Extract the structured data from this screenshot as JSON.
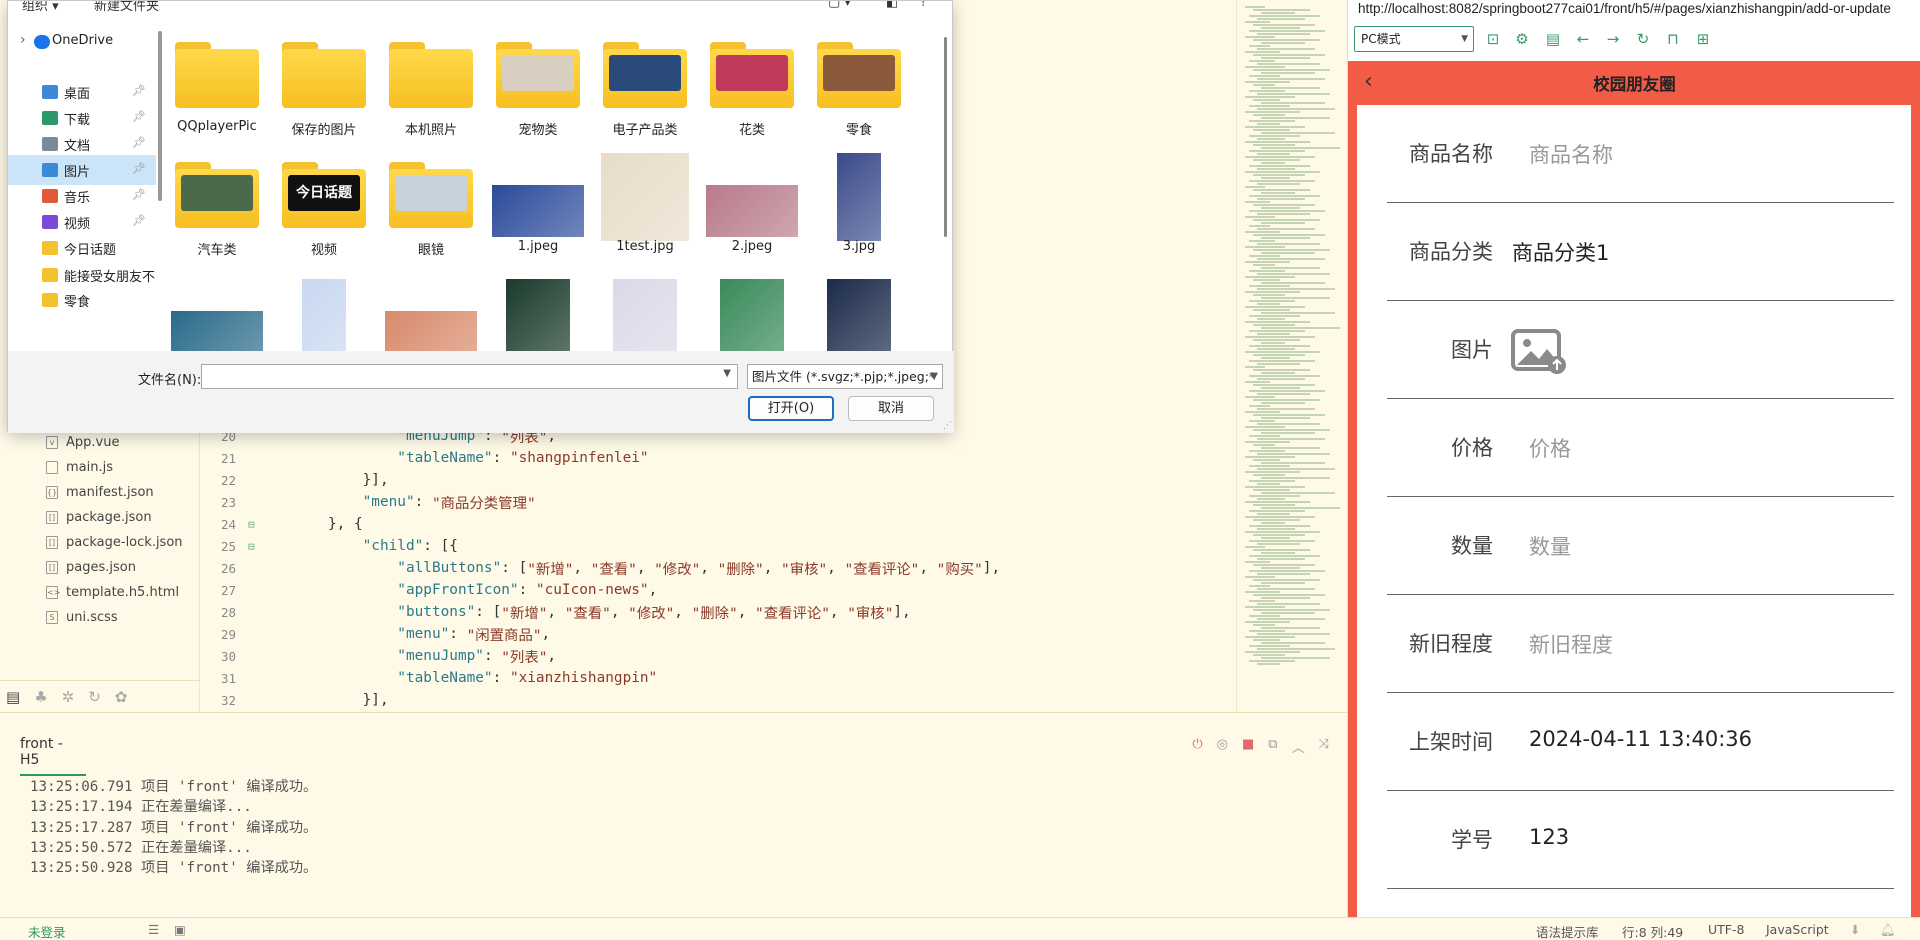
{
  "dialog": {
    "toolbar": {
      "organize": "组织 ▾",
      "new_folder": "新建文件夹"
    },
    "nav": [
      {
        "label": "OneDrive",
        "color": "#1a73e8",
        "pinned": false,
        "expander": true
      },
      {
        "label": "桌面",
        "color": "#3a8ad8",
        "pinned": true
      },
      {
        "label": "下载",
        "color": "#2a9a6a",
        "pinned": true
      },
      {
        "label": "文档",
        "color": "#7a8a9a",
        "pinned": true
      },
      {
        "label": "图片",
        "color": "#3a8ad8",
        "pinned": true,
        "selected": true
      },
      {
        "label": "音乐",
        "color": "#e05a3a",
        "pinned": true
      },
      {
        "label": "视频",
        "color": "#7a4ad8",
        "pinned": true
      },
      {
        "label": "今日话题",
        "color": "#f3c22e",
        "pinned": false
      },
      {
        "label": "能接受女朋友不",
        "color": "#f3c22e",
        "pinned": false
      },
      {
        "label": "零食",
        "color": "#f3c22e",
        "pinned": false
      }
    ],
    "items": [
      {
        "label": "QQplayerPic",
        "kind": "folder"
      },
      {
        "label": "保存的图片",
        "kind": "folder"
      },
      {
        "label": "本机照片",
        "kind": "folder"
      },
      {
        "label": "宠物类",
        "kind": "folder",
        "thumb": "#d9cfc0"
      },
      {
        "label": "电子产品类",
        "kind": "folder",
        "thumb": "#2a4a7a"
      },
      {
        "label": "花类",
        "kind": "folder",
        "thumb": "#c03a5a"
      },
      {
        "label": "零食",
        "kind": "folder",
        "thumb": "#8a5a3a"
      },
      {
        "label": "汽车类",
        "kind": "folder",
        "thumb": "#4a6a4a"
      },
      {
        "label": "视频",
        "kind": "folder",
        "thumb": "#111111",
        "thumb_text": "今日话题"
      },
      {
        "label": "眼镜",
        "kind": "folder",
        "thumb": "#c8d2dc"
      },
      {
        "label": "1.jpeg",
        "kind": "image",
        "color": "#2a4a9a"
      },
      {
        "label": "1test.jpg",
        "kind": "image",
        "color": "#e8dcc8"
      },
      {
        "label": "2.jpeg",
        "kind": "image",
        "color": "#b87a8a"
      },
      {
        "label": "3.jpg",
        "kind": "image",
        "color": "#3a4a8a"
      },
      {
        "label": "",
        "kind": "image",
        "color": "#2a6a8a"
      },
      {
        "label": "",
        "kind": "image",
        "color": "#c8d8f0"
      },
      {
        "label": "",
        "kind": "image",
        "color": "#d88a6a"
      },
      {
        "label": "",
        "kind": "image",
        "color": "#1a3a2a"
      },
      {
        "label": "",
        "kind": "image",
        "color": "#ddd8e8"
      },
      {
        "label": "",
        "kind": "image",
        "color": "#3a8a5a"
      },
      {
        "label": "",
        "kind": "image",
        "color": "#1a2a4a"
      }
    ],
    "filename_label": "文件名(N):",
    "filename_value": "",
    "filetype": "图片文件 (*.svgz;*.pjp;*.jpeg;*",
    "open_button": "打开(O)",
    "cancel_button": "取消"
  },
  "project_tree": {
    "files": [
      {
        "name": "App.vue",
        "icon": "v"
      },
      {
        "name": "main.js",
        "icon": ""
      },
      {
        "name": "manifest.json",
        "icon": "{}"
      },
      {
        "name": "package.json",
        "icon": "[]"
      },
      {
        "name": "package-lock.json",
        "icon": "[]"
      },
      {
        "name": "pages.json",
        "icon": "[]"
      },
      {
        "name": "template.h5.html",
        "icon": "<>"
      },
      {
        "name": "uni.scss",
        "icon": "S"
      }
    ]
  },
  "code": {
    "lines": [
      {
        "num": "20",
        "fold": "",
        "indent": 8,
        "parts": [
          [
            "k",
            "\"menuJump\""
          ],
          [
            "p",
            ": "
          ],
          [
            "s",
            "\"列表\""
          ],
          [
            "p",
            ","
          ]
        ]
      },
      {
        "num": "21",
        "fold": "",
        "indent": 8,
        "parts": [
          [
            "k",
            "\"tableName\""
          ],
          [
            "p",
            ": "
          ],
          [
            "s",
            "\"shangpinfenlei\""
          ]
        ]
      },
      {
        "num": "22",
        "fold": "",
        "indent": 6,
        "parts": [
          [
            "p",
            "}],"
          ]
        ]
      },
      {
        "num": "23",
        "fold": "",
        "indent": 6,
        "parts": [
          [
            "k",
            "\"menu\""
          ],
          [
            "p",
            ": "
          ],
          [
            "s",
            "\"商品分类管理\""
          ]
        ]
      },
      {
        "num": "24",
        "fold": "⊟",
        "indent": 4,
        "parts": [
          [
            "p",
            "}, {"
          ]
        ]
      },
      {
        "num": "25",
        "fold": "⊟",
        "indent": 6,
        "parts": [
          [
            "k",
            "\"child\""
          ],
          [
            "p",
            ": [{"
          ]
        ]
      },
      {
        "num": "26",
        "fold": "",
        "indent": 8,
        "parts": [
          [
            "k",
            "\"allButtons\""
          ],
          [
            "p",
            ": ["
          ],
          [
            "s",
            "\"新增\""
          ],
          [
            "p",
            ", "
          ],
          [
            "s",
            "\"查看\""
          ],
          [
            "p",
            ", "
          ],
          [
            "s",
            "\"修改\""
          ],
          [
            "p",
            ", "
          ],
          [
            "s",
            "\"删除\""
          ],
          [
            "p",
            ", "
          ],
          [
            "s",
            "\"审核\""
          ],
          [
            "p",
            ", "
          ],
          [
            "s",
            "\"查看评论\""
          ],
          [
            "p",
            ", "
          ],
          [
            "s",
            "\"购买\""
          ],
          [
            "p",
            "],"
          ]
        ]
      },
      {
        "num": "27",
        "fold": "",
        "indent": 8,
        "parts": [
          [
            "k",
            "\"appFrontIcon\""
          ],
          [
            "p",
            ": "
          ],
          [
            "s",
            "\"cuIcon-news\""
          ],
          [
            "p",
            ","
          ]
        ]
      },
      {
        "num": "28",
        "fold": "",
        "indent": 8,
        "parts": [
          [
            "k",
            "\"buttons\""
          ],
          [
            "p",
            ": ["
          ],
          [
            "s",
            "\"新增\""
          ],
          [
            "p",
            ", "
          ],
          [
            "s",
            "\"查看\""
          ],
          [
            "p",
            ", "
          ],
          [
            "s",
            "\"修改\""
          ],
          [
            "p",
            ", "
          ],
          [
            "s",
            "\"删除\""
          ],
          [
            "p",
            ", "
          ],
          [
            "s",
            "\"查看评论\""
          ],
          [
            "p",
            ", "
          ],
          [
            "s",
            "\"审核\""
          ],
          [
            "p",
            "],"
          ]
        ]
      },
      {
        "num": "29",
        "fold": "",
        "indent": 8,
        "parts": [
          [
            "k",
            "\"menu\""
          ],
          [
            "p",
            ": "
          ],
          [
            "s",
            "\"闲置商品\""
          ],
          [
            "p",
            ","
          ]
        ]
      },
      {
        "num": "30",
        "fold": "",
        "indent": 8,
        "parts": [
          [
            "k",
            "\"menuJump\""
          ],
          [
            "p",
            ": "
          ],
          [
            "s",
            "\"列表\""
          ],
          [
            "p",
            ","
          ]
        ]
      },
      {
        "num": "31",
        "fold": "",
        "indent": 8,
        "parts": [
          [
            "k",
            "\"tableName\""
          ],
          [
            "p",
            ": "
          ],
          [
            "s",
            "\"xianzhishangpin\""
          ]
        ]
      },
      {
        "num": "32",
        "fold": "",
        "indent": 6,
        "parts": [
          [
            "p",
            "}],"
          ]
        ]
      }
    ]
  },
  "console": {
    "tab": "front - H5",
    "logs": [
      "13:25:06.791 项目 'front' 编译成功。",
      "13:25:17.194 正在差量编译...",
      "13:25:17.287 项目 'front' 编译成功。",
      "13:25:50.572 正在差量编译...",
      "13:25:50.928 项目 'front' 编译成功。"
    ]
  },
  "statusbar": {
    "login": "未登录",
    "hint": "语法提示库",
    "position": "行:8  列:49",
    "encoding": "UTF-8",
    "language": "JavaScript"
  },
  "browser": {
    "url": "http://localhost:8082/springboot277cai01/front/h5/#/pages/xianzhishangpin/add-or-update",
    "mode": "PC模式",
    "page_title": "校园朋友圈",
    "accent": "#f25b45",
    "form": [
      {
        "label": "商品名称",
        "value": "",
        "placeholder": "商品名称"
      },
      {
        "label": "商品分类",
        "value": "商品分类1",
        "placeholder": ""
      },
      {
        "label": "图片",
        "value": "",
        "placeholder": "",
        "image": true
      },
      {
        "label": "价格",
        "value": "",
        "placeholder": "价格"
      },
      {
        "label": "数量",
        "value": "",
        "placeholder": "数量"
      },
      {
        "label": "新旧程度",
        "value": "",
        "placeholder": "新旧程度"
      },
      {
        "label": "上架时间",
        "value": "2024-04-11 13:40:36",
        "placeholder": ""
      },
      {
        "label": "学号",
        "value": "123",
        "placeholder": ""
      }
    ]
  }
}
